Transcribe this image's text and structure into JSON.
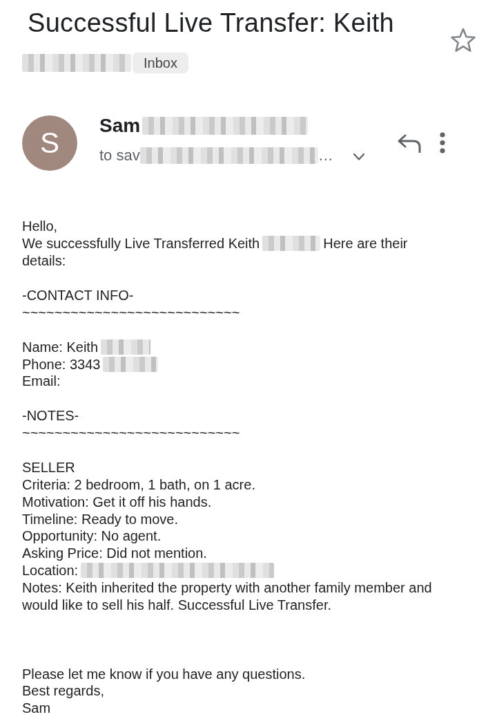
{
  "header": {
    "subject": "Successful Live Transfer: Keith",
    "starred": false,
    "tags": [
      {
        "kind": "redacted"
      },
      {
        "kind": "label",
        "text": "Inbox"
      }
    ]
  },
  "sender": {
    "avatar_letter": "S",
    "name": [
      {
        "kind": "text",
        "text": "Sam"
      },
      {
        "kind": "redacted"
      }
    ],
    "recipients": [
      {
        "kind": "text",
        "text": "to sav"
      },
      {
        "kind": "redacted"
      },
      {
        "kind": "text",
        "text": "…"
      }
    ],
    "details_expanded": false
  },
  "body": {
    "lines": [
      {
        "kind": "line",
        "parts": [
          {
            "kind": "text",
            "text": "Hello,"
          }
        ]
      },
      {
        "kind": "line",
        "parts": [
          {
            "kind": "text",
            "text": "We successfully Live Transferred Keith"
          },
          {
            "kind": "redacted"
          },
          {
            "kind": "text",
            "text": "Here are their"
          }
        ]
      },
      {
        "kind": "line",
        "parts": [
          {
            "kind": "text",
            "text": "details:"
          }
        ]
      },
      {
        "kind": "blank"
      },
      {
        "kind": "line",
        "parts": [
          {
            "kind": "text",
            "text": "-CONTACT INFO-"
          }
        ]
      },
      {
        "kind": "line",
        "parts": [
          {
            "kind": "text",
            "text": "~~~~~~~~~~~~~~~~~~~~~~~~~~~"
          }
        ]
      },
      {
        "kind": "blank"
      },
      {
        "kind": "line",
        "parts": [
          {
            "kind": "text",
            "text": "Name: Keith"
          },
          {
            "kind": "redacted"
          }
        ]
      },
      {
        "kind": "line",
        "parts": [
          {
            "kind": "text",
            "text": "Phone: 3343"
          },
          {
            "kind": "redacted"
          }
        ]
      },
      {
        "kind": "line",
        "parts": [
          {
            "kind": "text",
            "text": "Email:"
          }
        ]
      },
      {
        "kind": "blank"
      },
      {
        "kind": "line",
        "parts": [
          {
            "kind": "text",
            "text": "-NOTES-"
          }
        ]
      },
      {
        "kind": "line",
        "parts": [
          {
            "kind": "text",
            "text": "~~~~~~~~~~~~~~~~~~~~~~~~~~~"
          }
        ]
      },
      {
        "kind": "blank"
      },
      {
        "kind": "line",
        "parts": [
          {
            "kind": "text",
            "text": "SELLER"
          }
        ]
      },
      {
        "kind": "line",
        "parts": [
          {
            "kind": "text",
            "text": "Criteria: 2 bedroom, 1 bath, on 1 acre."
          }
        ]
      },
      {
        "kind": "line",
        "parts": [
          {
            "kind": "text",
            "text": "Motivation: Get it off his hands."
          }
        ]
      },
      {
        "kind": "line",
        "parts": [
          {
            "kind": "text",
            "text": "Timeline: Ready to move."
          }
        ]
      },
      {
        "kind": "line",
        "parts": [
          {
            "kind": "text",
            "text": "Opportunity: No agent."
          }
        ]
      },
      {
        "kind": "line",
        "parts": [
          {
            "kind": "text",
            "text": "Asking Price: Did not mention."
          }
        ]
      },
      {
        "kind": "line",
        "parts": [
          {
            "kind": "text",
            "text": "Location:"
          },
          {
            "kind": "redacted"
          }
        ]
      },
      {
        "kind": "line",
        "parts": [
          {
            "kind": "text",
            "text": "Notes: Keith inherited the property with another family member and"
          }
        ]
      },
      {
        "kind": "line",
        "parts": [
          {
            "kind": "text",
            "text": "would like to sell his half. Successful Live Transfer."
          }
        ]
      },
      {
        "kind": "blank"
      },
      {
        "kind": "blank"
      },
      {
        "kind": "blank"
      },
      {
        "kind": "line",
        "parts": [
          {
            "kind": "text",
            "text": "Please let me know if you have any questions."
          }
        ]
      },
      {
        "kind": "line",
        "parts": [
          {
            "kind": "text",
            "text": "Best regards,"
          }
        ]
      },
      {
        "kind": "line",
        "parts": [
          {
            "kind": "text",
            "text": "Sam"
          }
        ]
      }
    ]
  }
}
